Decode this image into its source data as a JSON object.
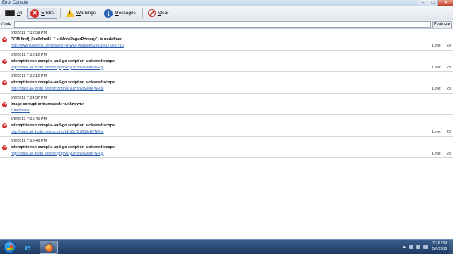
{
  "window": {
    "title": "Error Console"
  },
  "window_controls": {
    "minimize": "–",
    "maximize": "□",
    "close": "✕"
  },
  "toolbar": {
    "all": {
      "pre": "",
      "key": "A",
      "post": "ll",
      "icon": "console-icon"
    },
    "errors": {
      "pre": "",
      "key": "E",
      "post": "rrors",
      "icon": "error-icon"
    },
    "warnings": {
      "pre": "",
      "key": "W",
      "post": "arnings",
      "icon": "warning-icon"
    },
    "messages": {
      "pre": "",
      "key": "M",
      "post": "essages",
      "icon": "info-icon"
    },
    "clear": {
      "pre": "",
      "key": "C",
      "post": "lear",
      "icon": "clear-icon"
    }
  },
  "codebar": {
    "label": "Code:",
    "value": "",
    "evaluate": "Evaluate"
  },
  "entries": [
    {
      "timestamp": "5/6/2012 7:12:59 PM",
      "message": "DOM.find(_0xe0dbx41, \"..uiMorePagerPrimary\") is undefined",
      "source": "http://www.facebook.com/pages/FB-Wall-Manager/199384176806715",
      "line_label": "Line:",
      "line": "29"
    },
    {
      "timestamp": "5/6/2012 7:13:12 PM",
      "message": "attempt to run compile-and-go script on a cleared scope",
      "source": "http://static.ak.fbcdn.net/rsrc.php/v1/y0/r/5n2l59eBPNR.js",
      "line_label": "Line:",
      "line": "28"
    },
    {
      "timestamp": "5/6/2012 7:13:12 PM",
      "message": "attempt to run compile-and-go script on a cleared scope",
      "source": "http://static.ak.fbcdn.net/rsrc.php/v1/y0/r/5n2l59eBPNR.js",
      "line_label": "Line:",
      "line": "28"
    },
    {
      "timestamp": "5/6/2012 7:14:37 PM",
      "message": "Image corrupt or truncated: <unknown>",
      "source": "<unknown>",
      "line_label": "",
      "line": ""
    },
    {
      "timestamp": "5/6/2012 7:15:46 PM",
      "message": "attempt to run compile-and-go script on a cleared scope",
      "source": "http://static.ak.fbcdn.net/rsrc.php/v1/y0/r/5n2l59eBPNR.js",
      "line_label": "Line:",
      "line": "28"
    },
    {
      "timestamp": "5/6/2012 7:15:46 PM",
      "message": "attempt to run compile-and-go script on a cleared scope",
      "source": "http://static.ak.fbcdn.net/rsrc.php/v1/y0/r/5n2l59eBPNR.js",
      "line_label": "Line:",
      "line": "28"
    }
  ],
  "taskbar": {
    "apps": [
      "internet-explorer-icon",
      "firefox-icon"
    ],
    "clock": {
      "time": "7:16 PM",
      "date": "5/6/2012"
    }
  },
  "colors": {
    "error": "#d12f2f",
    "link": "#2a5db0",
    "taskbar": "#1d3a63",
    "title_bg": "#d9e6f4"
  }
}
